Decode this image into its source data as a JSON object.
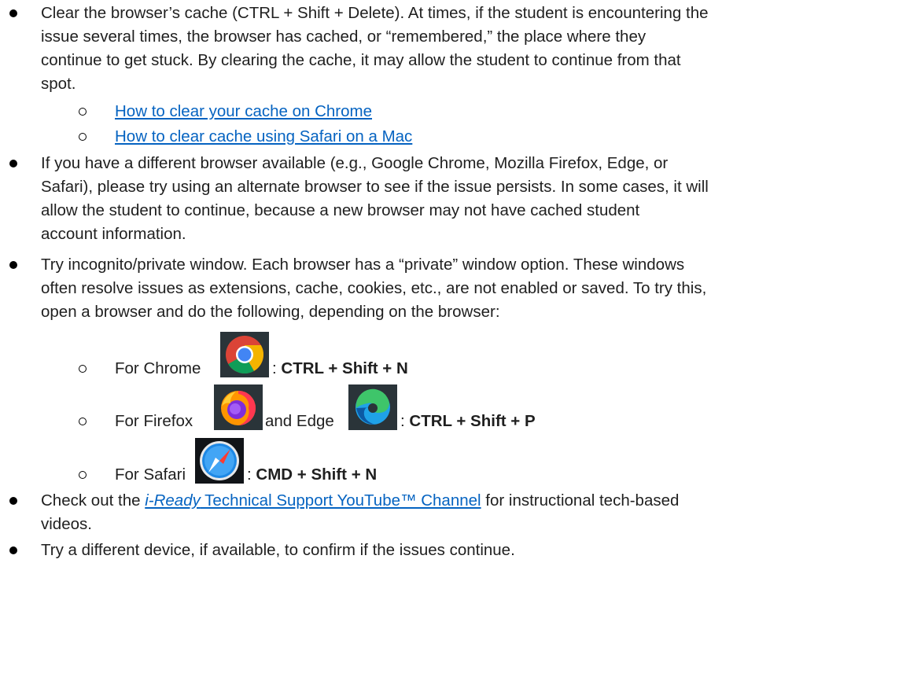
{
  "bullets": [
    {
      "lines": [
        "Clear the browser’s cache (CTRL + Shift + Delete). At times, if the student is encountering the",
        "issue several times, the browser has cached, or “remembered,” the place where they",
        "continue to get stuck. By clearing the cache, it may allow the student to continue from that",
        "spot."
      ],
      "links": [
        "How to clear your cache on Chrome",
        "How to clear cache using Safari on a Mac"
      ]
    },
    {
      "lines": [
        "If you have a different browser available (e.g., Google Chrome, Mozilla Firefox, Edge, or",
        "Safari), please try using an alternate browser to see if the issue persists. In some cases, it will",
        "allow the student to continue, because a new browser may not have cached student",
        "account information."
      ]
    },
    {
      "lines": [
        "Try incognito/private window. Each browser has a “private” window option. These windows",
        "often resolve issues as extensions, cache, cookies, etc., are not enabled or saved. To try this,",
        "open a browser and do the following, depending on the browser:"
      ],
      "shortcuts": {
        "chrome_prefix": "For Chrome",
        "chrome_keys": "CTRL + Shift + N",
        "firefox_prefix": "For Firefox",
        "edge_mid": "and Edge",
        "firefox_edge_keys": "CTRL + Shift + P",
        "safari_prefix": "For Safari",
        "safari_keys": "CMD + Shift + N",
        "colon": ": "
      }
    },
    {
      "prefix": "Check out the ",
      "link_italic": "i-Ready",
      "link_rest": " Technical Support YouTube™ Channel",
      "suffix": " for instructional tech-based",
      "line2": "videos."
    },
    {
      "line": "Try a different device, if available, to confirm if the issues continue."
    }
  ],
  "icons": {
    "chrome": "chrome-icon",
    "firefox": "firefox-icon",
    "edge": "edge-icon",
    "safari": "safari-icon"
  },
  "colors": {
    "link": "#0563c1",
    "icon_background": "#2a3439"
  }
}
